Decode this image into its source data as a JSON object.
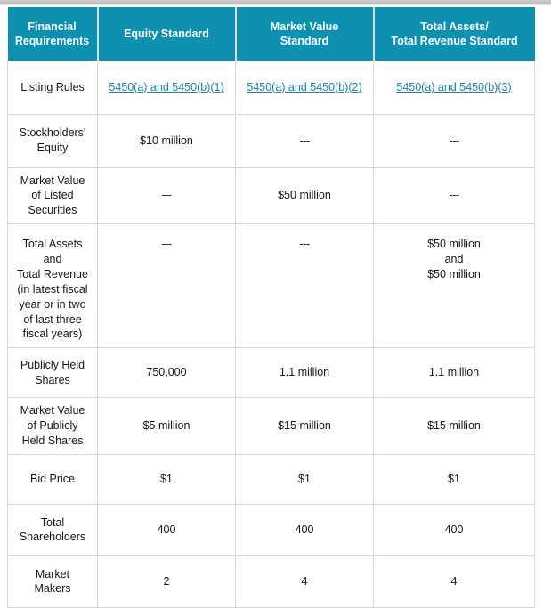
{
  "colors": {
    "header_bg": "#0e90b0",
    "header_text": "#ffffff",
    "link": "#1a82ab",
    "body_text": "#161616",
    "grid_line": "#d6d6d6",
    "top_bar": "#c4c4c4"
  },
  "table": {
    "columns": [
      {
        "id": "financial-requirements",
        "lines": [
          "Financial",
          "Requirements"
        ]
      },
      {
        "id": "equity-standard",
        "lines": [
          "Equity Standard"
        ]
      },
      {
        "id": "market-value-standard",
        "lines": [
          "Market Value",
          "Standard"
        ]
      },
      {
        "id": "total-assets-total-revenue-standard",
        "lines": [
          "Total Assets/",
          "Total Revenue Standard"
        ]
      }
    ],
    "rows": [
      {
        "id": "listing-rules",
        "label_lines": [
          "Listing Rules"
        ],
        "cells": [
          {
            "type": "link",
            "text": "5450(a) and 5450(b)(1)"
          },
          {
            "type": "link",
            "text": "5450(a) and 5450(b)(2)"
          },
          {
            "type": "link",
            "text": "5450(a) and 5450(b)(3)"
          }
        ]
      },
      {
        "id": "stockholders-equity",
        "label_lines": [
          "Stockholders'",
          "Equity"
        ],
        "cells": [
          {
            "type": "text",
            "lines": [
              "$10 million"
            ]
          },
          {
            "type": "text",
            "lines": [
              "---"
            ]
          },
          {
            "type": "text",
            "lines": [
              "---"
            ]
          }
        ]
      },
      {
        "id": "market-value-of-listed-securities",
        "label_lines": [
          "Market Value",
          "of Listed",
          "Securities"
        ],
        "cells": [
          {
            "type": "text",
            "lines": [
              "---"
            ]
          },
          {
            "type": "text",
            "lines": [
              "$50 million"
            ]
          },
          {
            "type": "text",
            "lines": [
              "---"
            ]
          }
        ]
      },
      {
        "id": "total-assets-and-total-revenue",
        "label_lines": [
          "Total Assets",
          "and",
          "Total Revenue",
          "(in latest fiscal",
          "year or in two",
          "of last three",
          "fiscal years)"
        ],
        "cells": [
          {
            "type": "text",
            "lines": [
              "---"
            ]
          },
          {
            "type": "text",
            "lines": [
              "---"
            ]
          },
          {
            "type": "text",
            "lines": [
              "$50 million",
              "and",
              "$50 million"
            ]
          }
        ]
      },
      {
        "id": "publicly-held-shares",
        "label_lines": [
          "Publicly Held",
          "Shares"
        ],
        "cells": [
          {
            "type": "text",
            "lines": [
              "750,000"
            ]
          },
          {
            "type": "text",
            "lines": [
              "1.1 million"
            ]
          },
          {
            "type": "text",
            "lines": [
              "1.1 million"
            ]
          }
        ]
      },
      {
        "id": "market-value-of-publicly-held-shares",
        "label_lines": [
          "Market Value",
          "of Publicly",
          "Held Shares"
        ],
        "cells": [
          {
            "type": "text",
            "lines": [
              "$5 million"
            ]
          },
          {
            "type": "text",
            "lines": [
              "$15 million"
            ]
          },
          {
            "type": "text",
            "lines": [
              "$15 million"
            ]
          }
        ]
      },
      {
        "id": "bid-price",
        "label_lines": [
          "Bid Price"
        ],
        "cells": [
          {
            "type": "text",
            "lines": [
              "$1"
            ]
          },
          {
            "type": "text",
            "lines": [
              "$1"
            ]
          },
          {
            "type": "text",
            "lines": [
              "$1"
            ]
          }
        ]
      },
      {
        "id": "total-shareholders",
        "label_lines": [
          "Total",
          "Shareholders"
        ],
        "cells": [
          {
            "type": "text",
            "lines": [
              "400"
            ]
          },
          {
            "type": "text",
            "lines": [
              "400"
            ]
          },
          {
            "type": "text",
            "lines": [
              "400"
            ]
          }
        ]
      },
      {
        "id": "market-makers",
        "label_lines": [
          "Market",
          "Makers"
        ],
        "cells": [
          {
            "type": "text",
            "lines": [
              "2"
            ]
          },
          {
            "type": "text",
            "lines": [
              "4"
            ]
          },
          {
            "type": "text",
            "lines": [
              "4"
            ]
          }
        ]
      }
    ]
  }
}
